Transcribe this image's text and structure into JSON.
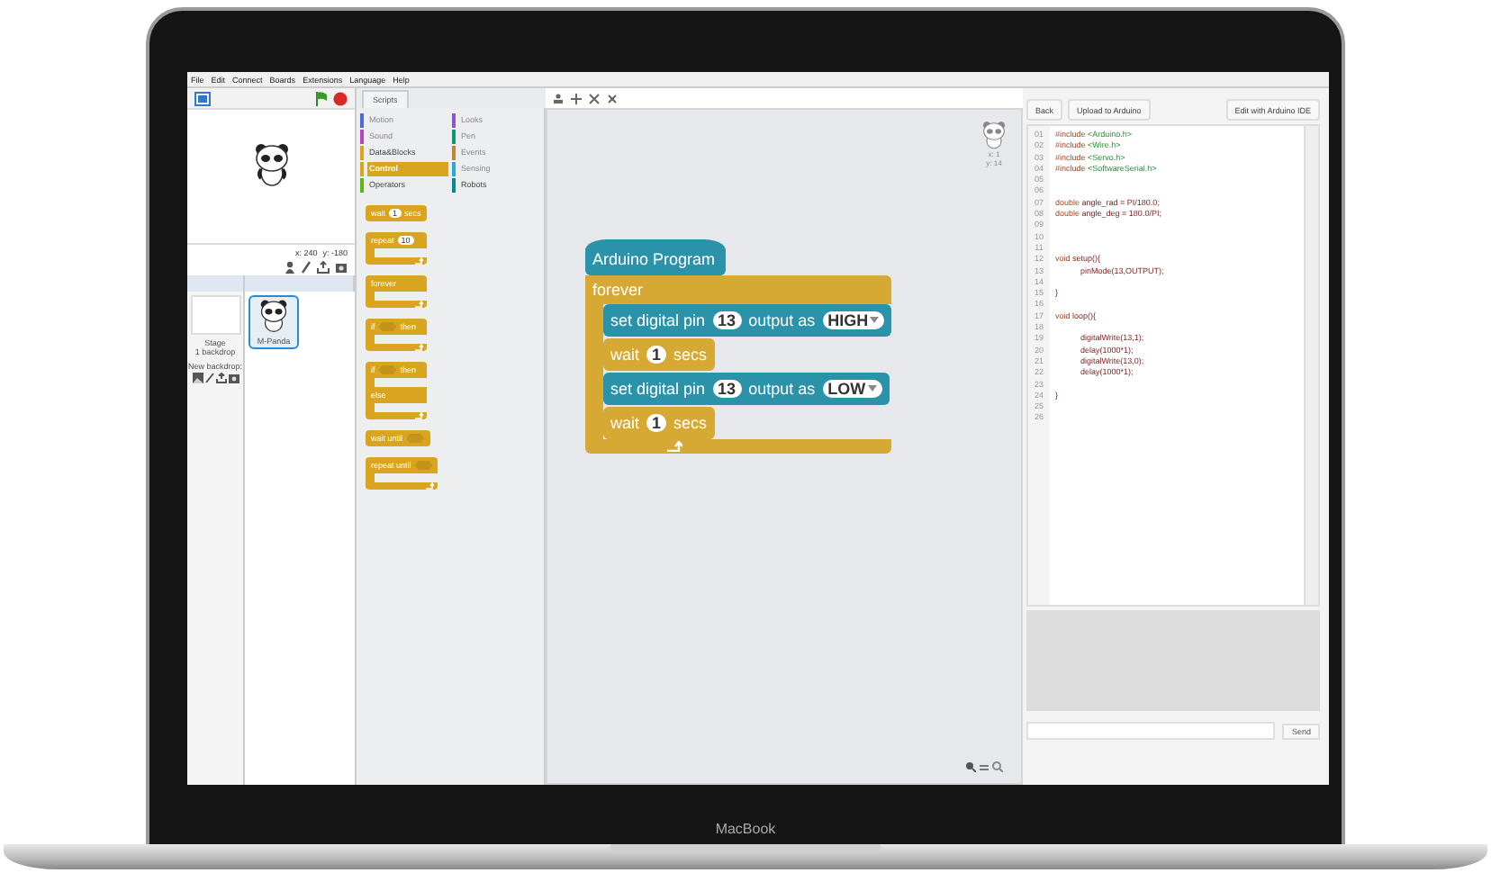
{
  "menu": [
    "File",
    "Edit",
    "Connect",
    "Boards",
    "Extensions",
    "Language",
    "Help"
  ],
  "stage": {
    "x_reading": "x: 240",
    "y_reading": "y: -180"
  },
  "sprites_panel": {
    "stage_label": "Stage",
    "backdrops": "1 backdrop",
    "new_backdrop": "New backdrop:",
    "sprites": [
      {
        "name": "M-Panda",
        "selected": true
      }
    ]
  },
  "palette": {
    "tab": "Scripts",
    "categories": [
      {
        "label": "Motion",
        "color": "#4a6cd4",
        "selected": false,
        "disabled": true
      },
      {
        "label": "Looks",
        "color": "#8a55d7",
        "selected": false,
        "disabled": true
      },
      {
        "label": "Sound",
        "color": "#bb42c3",
        "selected": false,
        "disabled": true
      },
      {
        "label": "Pen",
        "color": "#0e9a6c",
        "selected": false,
        "disabled": true
      },
      {
        "label": "Data&Blocks",
        "color": "#e0a020",
        "selected": false,
        "disabled": false
      },
      {
        "label": "Events",
        "color": "#c88330",
        "selected": false,
        "disabled": true
      },
      {
        "label": "Control",
        "color": "#d9a521",
        "selected": true,
        "disabled": false
      },
      {
        "label": "Sensing",
        "color": "#2ca5e2",
        "selected": false,
        "disabled": true
      },
      {
        "label": "Operators",
        "color": "#5cb712",
        "selected": false,
        "disabled": false
      },
      {
        "label": "Robots",
        "color": "#0a8698",
        "selected": false,
        "disabled": false
      }
    ],
    "blocks": [
      {
        "kind": "stack",
        "parts": [
          {
            "kind": "text",
            "t": "wait"
          },
          {
            "kind": "number",
            "t": "1"
          },
          {
            "kind": "text",
            "t": "secs"
          }
        ]
      },
      {
        "kind": "c",
        "parts": [
          {
            "kind": "text",
            "t": "repeat"
          },
          {
            "kind": "number",
            "t": "10"
          }
        ]
      },
      {
        "kind": "c",
        "parts": [
          {
            "kind": "text",
            "t": "forever"
          }
        ]
      },
      {
        "kind": "c",
        "parts": [
          {
            "kind": "text",
            "t": "if"
          },
          {
            "kind": "bool"
          },
          {
            "kind": "text",
            "t": "then"
          }
        ]
      },
      {
        "kind": "c-else",
        "else_label": "else",
        "parts": [
          {
            "kind": "text",
            "t": "if"
          },
          {
            "kind": "bool"
          },
          {
            "kind": "text",
            "t": "then"
          }
        ]
      },
      {
        "kind": "stack",
        "parts": [
          {
            "kind": "text",
            "t": "wait until"
          },
          {
            "kind": "bool"
          }
        ]
      },
      {
        "kind": "c",
        "parts": [
          {
            "kind": "text",
            "t": "repeat until"
          },
          {
            "kind": "bool"
          }
        ]
      }
    ]
  },
  "script": {
    "hat": "Arduino Program",
    "loop": {
      "label": "forever",
      "color": "#d5a933",
      "children": [
        {
          "color": "#2a93aa",
          "parts": [
            {
              "kind": "text",
              "t": "set digital pin"
            },
            {
              "kind": "number",
              "t": "13"
            },
            {
              "kind": "text",
              "t": "output as"
            },
            {
              "kind": "dropdown",
              "t": "HIGH"
            }
          ]
        },
        {
          "color": "#d5a933",
          "parts": [
            {
              "kind": "text",
              "t": "wait"
            },
            {
              "kind": "number",
              "t": "1"
            },
            {
              "kind": "text",
              "t": "secs"
            }
          ]
        },
        {
          "color": "#2a93aa",
          "parts": [
            {
              "kind": "text",
              "t": "set digital pin"
            },
            {
              "kind": "number",
              "t": "13"
            },
            {
              "kind": "text",
              "t": "output as"
            },
            {
              "kind": "dropdown",
              "t": "LOW"
            }
          ]
        },
        {
          "color": "#d5a933",
          "parts": [
            {
              "kind": "text",
              "t": "wait"
            },
            {
              "kind": "number",
              "t": "1"
            },
            {
              "kind": "text",
              "t": "secs"
            }
          ]
        }
      ]
    }
  },
  "sprite_info": {
    "x_reading": "x: 1",
    "y_reading": "y: 14"
  },
  "code_panel": {
    "buttons": [
      "Back",
      "Upload to Arduino",
      "Edit with Arduino IDE"
    ],
    "lines": [
      {
        "n": "01",
        "tokens": [
          {
            "kind": "keyword",
            "t": "#include"
          },
          {
            "kind": "string",
            "t": "<Arduino.h>"
          }
        ]
      },
      {
        "n": "02",
        "tokens": [
          {
            "kind": "keyword",
            "t": "#include"
          },
          {
            "kind": "string",
            "t": "<Wire.h>"
          }
        ]
      },
      {
        "n": "03",
        "tokens": [
          {
            "kind": "keyword",
            "t": "#include"
          },
          {
            "kind": "string",
            "t": "<Servo.h>"
          }
        ]
      },
      {
        "n": "04",
        "tokens": [
          {
            "kind": "keyword",
            "t": "#include"
          },
          {
            "kind": "string",
            "t": "<SoftwareSerial.h>"
          }
        ]
      },
      {
        "n": "05"
      },
      {
        "n": "06"
      },
      {
        "n": "07",
        "tokens": [
          {
            "kind": "keyword",
            "t": "double"
          },
          {
            "kind": "plain",
            "t": "angle_rad = PI/180.0;"
          }
        ]
      },
      {
        "n": "08",
        "tokens": [
          {
            "kind": "keyword",
            "t": "double"
          },
          {
            "kind": "plain",
            "t": "angle_deg = 180.0/PI;"
          }
        ]
      },
      {
        "n": "09"
      },
      {
        "n": "10"
      },
      {
        "n": "11"
      },
      {
        "n": "12",
        "tokens": [
          {
            "kind": "keyword",
            "t": "void"
          },
          {
            "kind": "plain",
            "t": "setup(){"
          }
        ]
      },
      {
        "n": "13",
        "indented": true,
        "tokens": [
          {
            "kind": "plain",
            "t": "pinMode(13,OUTPUT);"
          }
        ]
      },
      {
        "n": "14"
      },
      {
        "n": "15",
        "tokens": [
          {
            "kind": "plain",
            "t": "}"
          }
        ]
      },
      {
        "n": "16"
      },
      {
        "n": "17",
        "tokens": [
          {
            "kind": "keyword",
            "t": "void"
          },
          {
            "kind": "plain",
            "t": "loop(){"
          }
        ]
      },
      {
        "n": "18"
      },
      {
        "n": "19",
        "indented": true,
        "tokens": [
          {
            "kind": "plain",
            "t": "digitalWrite(13,1);"
          }
        ]
      },
      {
        "n": "20",
        "indented": true,
        "tokens": [
          {
            "kind": "plain",
            "t": "delay(1000*1);"
          }
        ]
      },
      {
        "n": "21",
        "indented": true,
        "tokens": [
          {
            "kind": "plain",
            "t": "digitalWrite(13,0);"
          }
        ]
      },
      {
        "n": "22",
        "indented": true,
        "tokens": [
          {
            "kind": "plain",
            "t": "delay(1000*1);"
          }
        ]
      },
      {
        "n": "23"
      },
      {
        "n": "24",
        "tokens": [
          {
            "kind": "plain",
            "t": "}"
          }
        ]
      },
      {
        "n": "25"
      },
      {
        "n": "26"
      }
    ],
    "send": "Send"
  },
  "brand": "MacBook"
}
